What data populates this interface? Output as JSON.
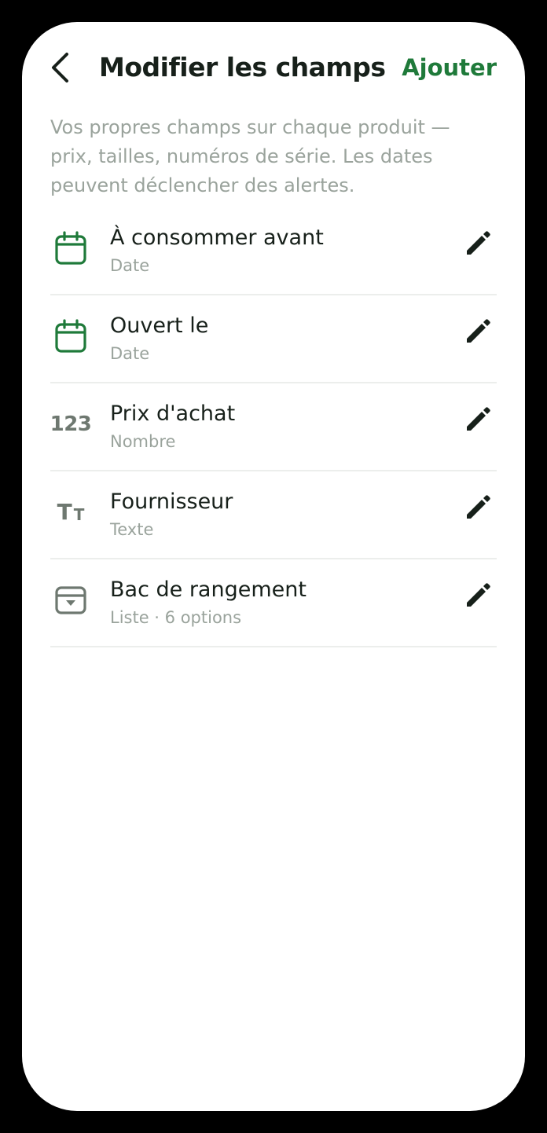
{
  "header": {
    "title": "Modifier les champs",
    "add_label": "Ajouter"
  },
  "description": "Vos propres champs sur chaque produit — prix, tailles, numéros de série. Les dates peuvent déclencher des alertes.",
  "fields": [
    {
      "title": "À consommer avant",
      "type": "Date",
      "icon": "calendar-icon"
    },
    {
      "title": "Ouvert le",
      "type": "Date",
      "icon": "calendar-icon"
    },
    {
      "title": "Prix d'achat",
      "type": "Nombre",
      "icon": "number-icon",
      "icon_text": "123"
    },
    {
      "title": "Fournisseur",
      "type": "Texte",
      "icon": "text-icon",
      "icon_text_big": "T",
      "icon_text_small": "T"
    },
    {
      "title": "Bac de rangement",
      "type": "Liste · 6 options",
      "icon": "dropdown-list-icon"
    }
  ],
  "colors": {
    "accent": "#1f7a3a",
    "title": "#17201a",
    "muted": "#9aa39c",
    "icon_gray": "#6e7870",
    "divider": "#eceeec"
  }
}
